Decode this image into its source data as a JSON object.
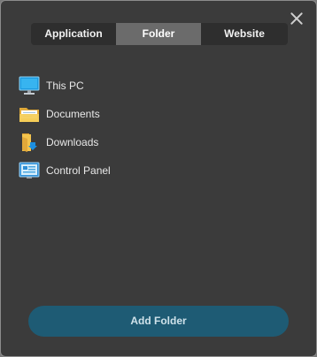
{
  "tabs": [
    {
      "label": "Application",
      "active": false
    },
    {
      "label": "Folder",
      "active": true
    },
    {
      "label": "Website",
      "active": false
    }
  ],
  "folders": [
    {
      "label": "This PC",
      "icon": "monitor-icon"
    },
    {
      "label": "Documents",
      "icon": "folder-icon"
    },
    {
      "label": "Downloads",
      "icon": "downloads-folder-icon"
    },
    {
      "label": "Control Panel",
      "icon": "control-panel-icon"
    }
  ],
  "add_button_label": "Add Folder",
  "colors": {
    "background": "#3b3b3b",
    "tab_active": "#6b6b6b",
    "tab_bar": "#2e2e2e",
    "accent_button": "#1e5b74"
  }
}
